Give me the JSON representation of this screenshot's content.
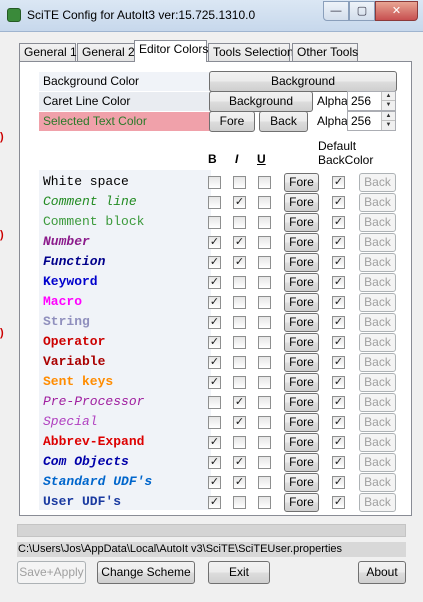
{
  "window": {
    "title": "SciTE Config for AutoIt3 ver:15.725.1310.0",
    "min_glyph": "—",
    "max_glyph": "▢",
    "close_glyph": "✕"
  },
  "tabs": [
    {
      "label": "General 1"
    },
    {
      "label": "General 2"
    },
    {
      "label": "Editor Colors"
    },
    {
      "label": "Tools Selection"
    },
    {
      "label": "Other Tools"
    }
  ],
  "colors": {
    "background": {
      "label": "Background Color",
      "button": "Background"
    },
    "caret": {
      "label": "Caret Line Color",
      "button": "Background",
      "alpha_label": "Alpha",
      "alpha": "256"
    },
    "selected": {
      "label": "Selected Text Color",
      "fore_button": "Fore",
      "back_button": "Back",
      "alpha_label": "Alpha",
      "alpha": "256",
      "bg": "#f0a1aa",
      "fg": "#2a7a2a"
    }
  },
  "headers": {
    "bold": "B",
    "italic": "I",
    "underline": "U",
    "default_back": "Default\nBackColor"
  },
  "style_rows": [
    {
      "name": "White space",
      "color": "#000000",
      "bold": false,
      "italic": false,
      "b": false,
      "i": false,
      "u": false,
      "fore": "Fore",
      "def": true,
      "back": "Back"
    },
    {
      "name": "Comment line",
      "color": "#228b22",
      "bold": false,
      "italic": true,
      "b": false,
      "i": true,
      "u": false,
      "fore": "Fore",
      "def": true,
      "back": "Back"
    },
    {
      "name": "Comment block",
      "color": "#3c9a3c",
      "bold": false,
      "italic": false,
      "b": false,
      "i": false,
      "u": false,
      "fore": "Fore",
      "def": true,
      "back": "Back"
    },
    {
      "name": "Number",
      "color": "#8b1a8b",
      "bold": true,
      "italic": true,
      "b": true,
      "i": true,
      "u": false,
      "fore": "Fore",
      "def": true,
      "back": "Back"
    },
    {
      "name": "Function",
      "color": "#00008b",
      "bold": true,
      "italic": true,
      "b": true,
      "i": true,
      "u": false,
      "fore": "Fore",
      "def": true,
      "back": "Back"
    },
    {
      "name": "Keyword",
      "color": "#0000cd",
      "bold": true,
      "italic": false,
      "b": true,
      "i": false,
      "u": false,
      "fore": "Fore",
      "def": true,
      "back": "Back"
    },
    {
      "name": "Macro",
      "color": "#ff00ff",
      "bold": true,
      "italic": false,
      "b": true,
      "i": false,
      "u": false,
      "fore": "Fore",
      "def": true,
      "back": "Back"
    },
    {
      "name": "String",
      "color": "#8f8fbd",
      "bold": true,
      "italic": false,
      "b": true,
      "i": false,
      "u": false,
      "fore": "Fore",
      "def": true,
      "back": "Back"
    },
    {
      "name": "Operator",
      "color": "#cc0000",
      "bold": true,
      "italic": false,
      "b": true,
      "i": false,
      "u": false,
      "fore": "Fore",
      "def": true,
      "back": "Back"
    },
    {
      "name": "Variable",
      "color": "#aa0000",
      "bold": true,
      "italic": false,
      "b": true,
      "i": false,
      "u": false,
      "fore": "Fore",
      "def": true,
      "back": "Back"
    },
    {
      "name": "Sent keys",
      "color": "#ff8c00",
      "bold": true,
      "italic": false,
      "b": true,
      "i": false,
      "u": false,
      "fore": "Fore",
      "def": true,
      "back": "Back"
    },
    {
      "name": "Pre-Processor",
      "color": "#a020a0",
      "bold": false,
      "italic": true,
      "b": false,
      "i": true,
      "u": false,
      "fore": "Fore",
      "def": true,
      "back": "Back"
    },
    {
      "name": "Special",
      "color": "#b040c0",
      "bold": false,
      "italic": true,
      "b": false,
      "i": true,
      "u": false,
      "fore": "Fore",
      "def": true,
      "back": "Back"
    },
    {
      "name": "Abbrev-Expand",
      "color": "#dd0000",
      "bold": true,
      "italic": false,
      "b": true,
      "i": false,
      "u": false,
      "fore": "Fore",
      "def": true,
      "back": "Back"
    },
    {
      "name": "Com Objects",
      "color": "#0000aa",
      "bold": true,
      "italic": true,
      "b": true,
      "i": true,
      "u": false,
      "fore": "Fore",
      "def": true,
      "back": "Back"
    },
    {
      "name": "Standard UDF's",
      "color": "#0066cc",
      "bold": true,
      "italic": true,
      "b": true,
      "i": true,
      "u": false,
      "fore": "Fore",
      "def": true,
      "back": "Back"
    },
    {
      "name": "User UDF's",
      "color": "#1a3aa0",
      "bold": true,
      "italic": false,
      "b": true,
      "i": false,
      "u": false,
      "fore": "Fore",
      "def": true,
      "back": "Back"
    }
  ],
  "path": "C:\\Users\\Jos\\AppData\\Local\\AutoIt v3\\SciTE\\SciTEUser.properties",
  "footer": {
    "save_apply": "Save+Apply",
    "change_scheme": "Change Scheme",
    "exit": "Exit",
    "about": "About"
  }
}
